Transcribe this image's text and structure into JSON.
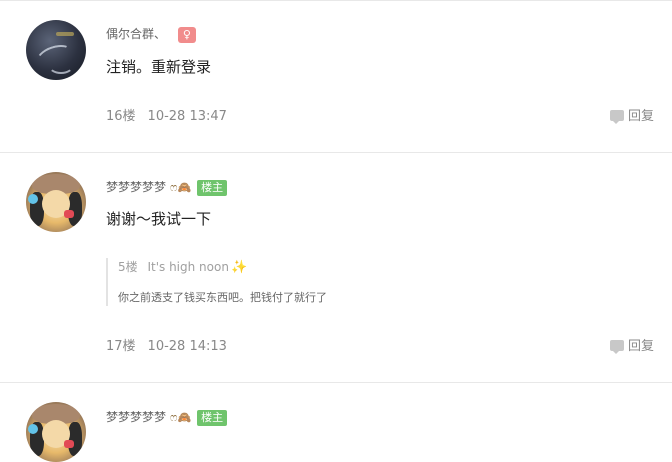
{
  "posts": [
    {
      "username": "偶尔合群、",
      "content": "注销。重新登录",
      "floor": "16楼",
      "time": "10-28 13:47",
      "reply_label": "回复",
      "tag_icon": "♀"
    },
    {
      "username": "梦梦梦梦梦",
      "emoji": "ෆ🙈",
      "badge": "楼主",
      "content": "谢谢～我试一下",
      "quote": {
        "floor": "5楼",
        "author": "It's high noon",
        "sparkle": "✨",
        "text": "你之前透支了钱买东西吧。把钱付了就行了"
      },
      "floor": "17楼",
      "time": "10-28 14:13",
      "reply_label": "回复"
    },
    {
      "username": "梦梦梦梦梦",
      "emoji": "ෆ🙈",
      "badge": "楼主"
    }
  ],
  "colors": {
    "badge_green": "#6fc46c",
    "tag_pink": "#f18c8c",
    "meta_gray": "#888888"
  }
}
